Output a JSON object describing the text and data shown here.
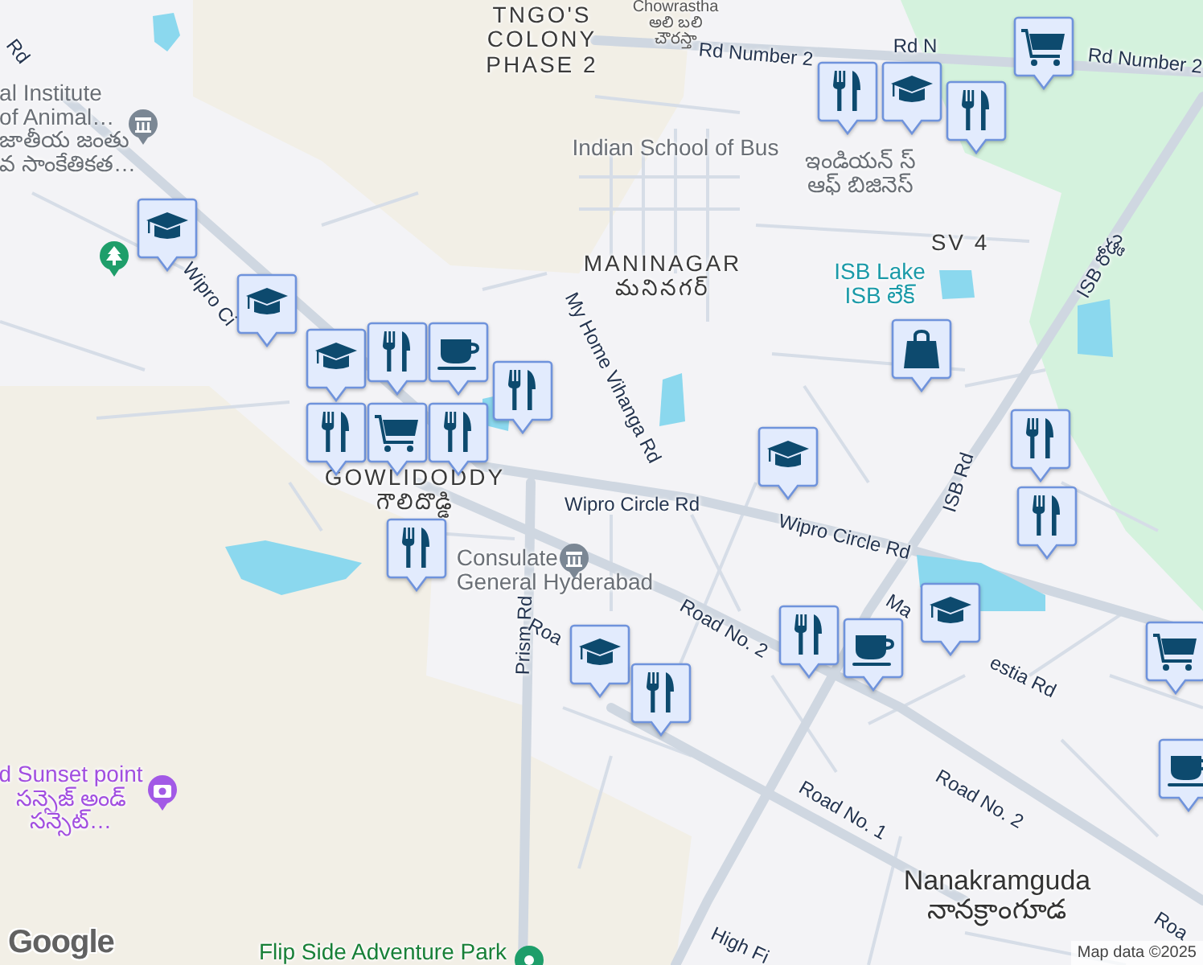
{
  "map": {
    "place_labels": [
      {
        "kind": "area",
        "lines": [
          "TNGO'S",
          "COLONY",
          "PHASE 2"
        ]
      },
      {
        "kind": "small",
        "lines": [
          "Chowrastha",
          "అలి బలి",
          "చౌరస్తా"
        ]
      },
      {
        "kind": "road",
        "lines": [
          "Rd Number 2"
        ]
      },
      {
        "kind": "road",
        "lines": [
          "Rd N"
        ]
      },
      {
        "kind": "road",
        "lines": [
          "Rd Number 2"
        ]
      },
      {
        "kind": "poi",
        "lines": [
          "al Institute",
          "of Animal…",
          "జాతీయ జంతు",
          "వ సాంకేతికత…"
        ]
      },
      {
        "kind": "road",
        "lines": [
          "Rd"
        ]
      },
      {
        "kind": "poi",
        "lines": [
          "Indian School of Bus"
        ]
      },
      {
        "kind": "poi",
        "lines": [
          "ఇండియన్ స్",
          "ఆఫ్ బిజినెస్"
        ]
      },
      {
        "kind": "area",
        "lines": [
          "MANINAGAR",
          "మనినగర్"
        ]
      },
      {
        "kind": "area",
        "lines": [
          "SV 4"
        ]
      },
      {
        "kind": "water",
        "lines": [
          "ISB Lake",
          "ISB లేక్"
        ]
      },
      {
        "kind": "road",
        "lines": [
          "ISB రోడ్డు"
        ]
      },
      {
        "kind": "road",
        "lines": [
          "My Home Vihanga Rd"
        ]
      },
      {
        "kind": "road",
        "lines": [
          "Wipro Ci"
        ]
      },
      {
        "kind": "area",
        "lines": [
          "GOWLIDODDY",
          "గౌలిదొడ్డి"
        ]
      },
      {
        "kind": "road",
        "lines": [
          "Wipro Circle Rd"
        ]
      },
      {
        "kind": "road",
        "lines": [
          "Wipro Circle Rd"
        ]
      },
      {
        "kind": "road",
        "lines": [
          "ISB Rd"
        ]
      },
      {
        "kind": "poi",
        "lines": [
          "Consulate",
          "General Hyderabad"
        ]
      },
      {
        "kind": "road",
        "lines": [
          "Prism Rd"
        ]
      },
      {
        "kind": "road",
        "lines": [
          "Roa"
        ]
      },
      {
        "kind": "road",
        "lines": [
          "Road No. 2"
        ]
      },
      {
        "kind": "road",
        "lines": [
          "Ma"
        ]
      },
      {
        "kind": "road",
        "lines": [
          "estia Rd"
        ]
      },
      {
        "kind": "road",
        "lines": [
          "Road No. 2"
        ]
      },
      {
        "kind": "road",
        "lines": [
          "Road No. 1"
        ]
      },
      {
        "kind": "town",
        "lines": [
          "Nanakramguda",
          "నానక్రాంగూడ"
        ]
      },
      {
        "kind": "road",
        "lines": [
          "Roa"
        ]
      },
      {
        "kind": "road",
        "lines": [
          "High Fi"
        ]
      },
      {
        "kind": "scenic",
        "lines": [
          "d Sunset point",
          "సన్సెజ్ అండ్",
          "సన్సెట్…"
        ]
      },
      {
        "kind": "park",
        "lines": [
          "Flip Side Adventure Park"
        ]
      }
    ],
    "poi_pins": [
      {
        "kind": "institution"
      },
      {
        "kind": "park"
      },
      {
        "kind": "institution"
      },
      {
        "kind": "scenic"
      },
      {
        "kind": "attraction"
      }
    ],
    "markers": [
      {
        "kind": "school"
      },
      {
        "kind": "school"
      },
      {
        "kind": "school"
      },
      {
        "kind": "restaurant"
      },
      {
        "kind": "cafe"
      },
      {
        "kind": "restaurant"
      },
      {
        "kind": "shopping_cart"
      },
      {
        "kind": "restaurant"
      },
      {
        "kind": "restaurant"
      },
      {
        "kind": "restaurant"
      },
      {
        "kind": "restaurant"
      },
      {
        "kind": "school"
      },
      {
        "kind": "restaurant"
      },
      {
        "kind": "shopping_cart"
      },
      {
        "kind": "shopping_bag"
      },
      {
        "kind": "school"
      },
      {
        "kind": "restaurant"
      },
      {
        "kind": "restaurant"
      },
      {
        "kind": "restaurant"
      },
      {
        "kind": "cafe"
      },
      {
        "kind": "school"
      },
      {
        "kind": "shopping_cart"
      },
      {
        "kind": "school"
      },
      {
        "kind": "restaurant"
      },
      {
        "kind": "cafe"
      }
    ],
    "logo": "Google",
    "attribution": "Map data ©2025"
  }
}
